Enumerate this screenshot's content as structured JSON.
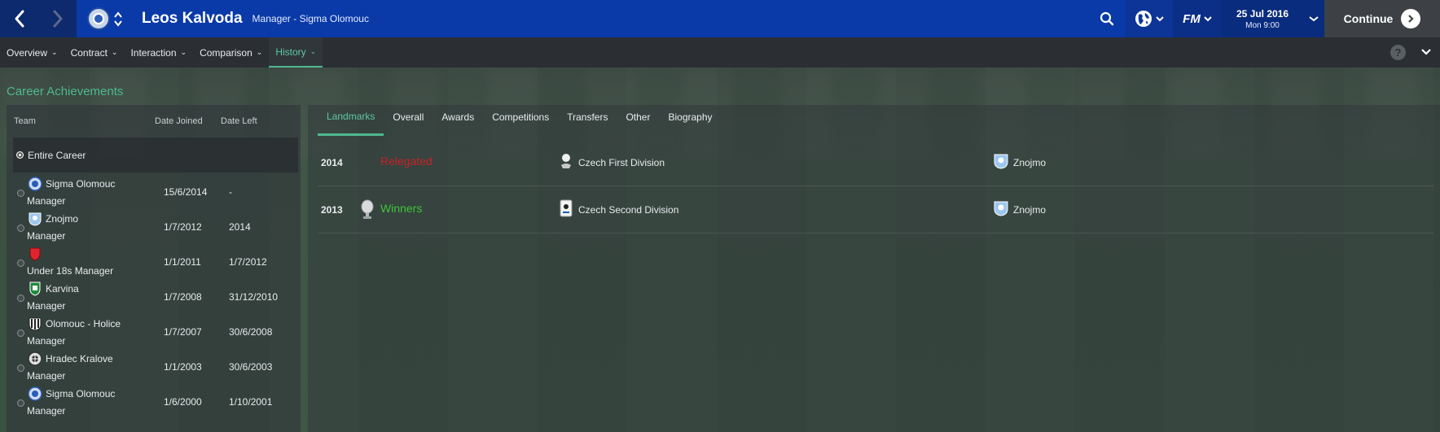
{
  "header": {
    "name": "Leos Kalvoda",
    "role": "Manager - Sigma Olomouc",
    "date": "25 Jul 2016",
    "time": "Mon 9:00",
    "continue_label": "Continue",
    "fm_label": "FM",
    "accent_color": "#0a3aa8"
  },
  "subnav": {
    "items": [
      "Overview",
      "Contract",
      "Interaction",
      "Comparison",
      "History"
    ],
    "active": "History",
    "help": "?"
  },
  "section_title": "Career Achievements",
  "career_table": {
    "headers": {
      "team": "Team",
      "joined": "Date Joined",
      "left": "Date Left"
    },
    "entire_career": "Entire Career",
    "rows": [
      {
        "team": "Sigma Olomouc",
        "role": "Manager",
        "joined": "15/6/2014",
        "left": "-",
        "crest": "sigma-crest"
      },
      {
        "team": "Znojmo",
        "role": "Manager",
        "joined": "1/7/2012",
        "left": "2014",
        "crest": "znojmo-crest"
      },
      {
        "team": "",
        "role": "Under 18s Manager",
        "joined": "1/1/2011",
        "left": "1/7/2012",
        "crest": "red-crest"
      },
      {
        "team": "Karvina",
        "role": "Manager",
        "joined": "1/7/2008",
        "left": "31/12/2010",
        "crest": "karvina-crest"
      },
      {
        "team": "Olomouc - Holice",
        "role": "Manager",
        "joined": "1/7/2007",
        "left": "30/6/2008",
        "crest": "holice-crest"
      },
      {
        "team": "Hradec Kralove",
        "role": "Manager",
        "joined": "1/1/2003",
        "left": "30/6/2003",
        "crest": "hradec-crest"
      },
      {
        "team": "Sigma Olomouc",
        "role": "Manager",
        "joined": "1/6/2000",
        "left": "1/10/2001",
        "crest": "sigma-crest"
      }
    ]
  },
  "tabs": [
    "Landmarks",
    "Overall",
    "Awards",
    "Competitions",
    "Transfers",
    "Other",
    "Biography"
  ],
  "active_tab": "Landmarks",
  "achievements": [
    {
      "year": "2014",
      "type": "Relegated",
      "competition": "Czech First Division",
      "club": "Znojmo",
      "color": "#c92228"
    },
    {
      "year": "2013",
      "type": "Winners",
      "competition": "Czech Second Division",
      "club": "Znojmo",
      "color": "#3fc43a"
    }
  ]
}
